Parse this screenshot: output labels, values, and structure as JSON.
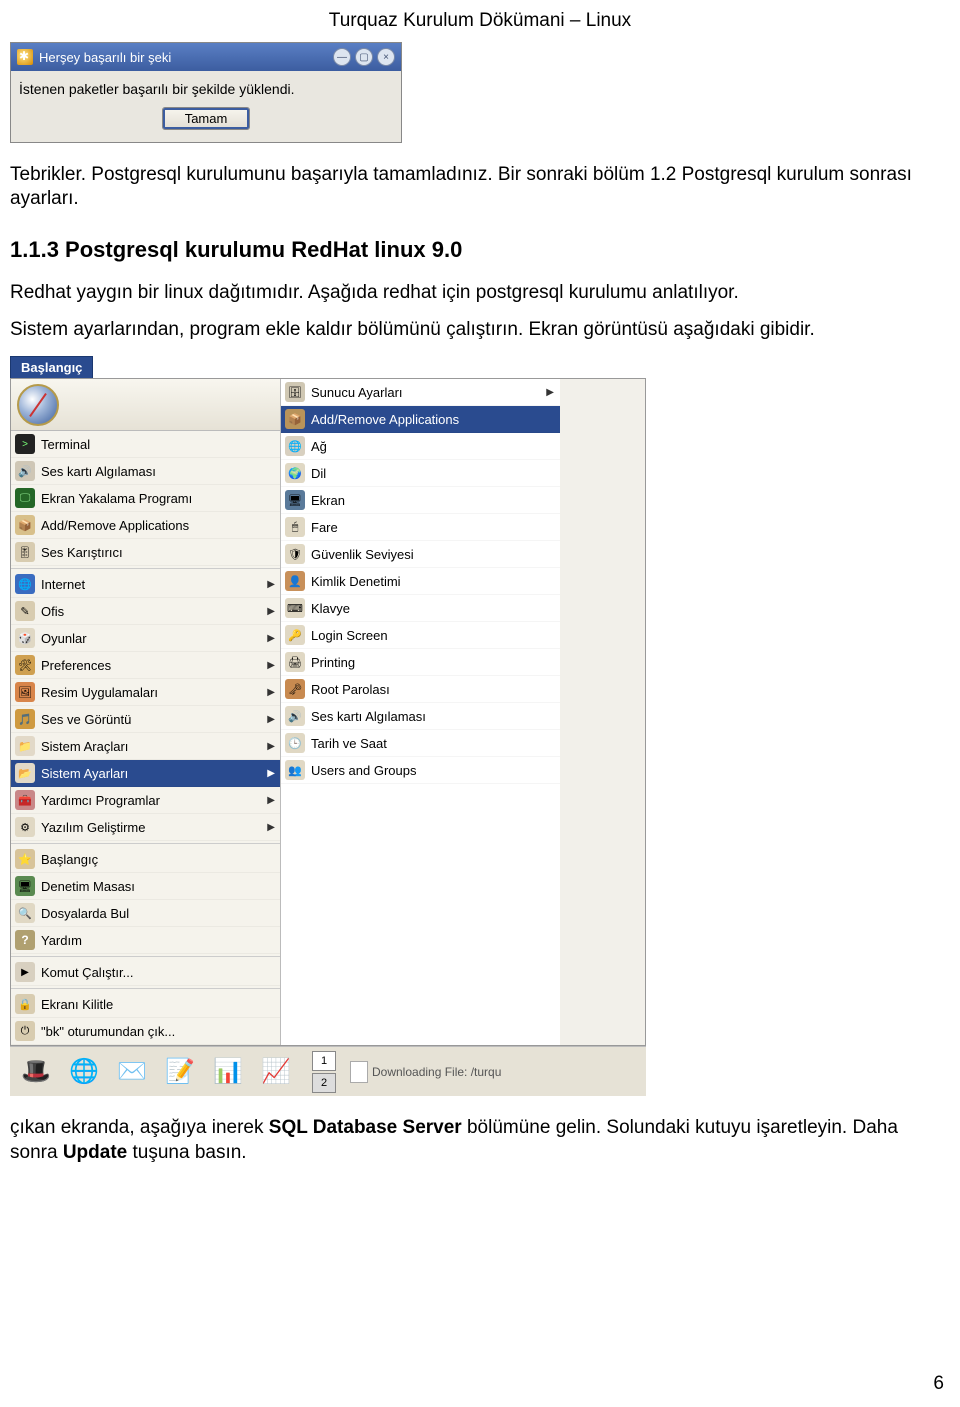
{
  "header": "Turquaz Kurulum Dökümani – Linux",
  "dialog": {
    "title": "Herşey başarılı bir şeki",
    "message": "İstenen paketler başarılı bir şekilde yüklendi.",
    "ok_label": "Tamam"
  },
  "para1": "Tebrikler. Postgresql kurulumunu başarıyla tamamladınız. Bir sonraki bölüm 1.2 Postgresql kurulum sonrası ayarları.",
  "heading": "1.1.3 Postgresql kurulumu RedHat linux 9.0",
  "para2": "Redhat yaygın bir linux dağıtımıdır. Aşağıda redhat için postgresql kurulumu anlatılıyor.",
  "para3": "Sistem ayarlarından, program ekle kaldır bölümünü çalıştırın. Ekran görüntüsü aşağıdaki gibidir.",
  "menu": {
    "start_label": "Başlangıç",
    "left": [
      {
        "label": "Terminal",
        "icon": "i-term",
        "arrow": false
      },
      {
        "label": "Ses kartı Algılaması",
        "icon": "i-sound",
        "arrow": false
      },
      {
        "label": "Ekran Yakalama Programı",
        "icon": "i-screen",
        "arrow": false
      },
      {
        "label": "Add/Remove Applications",
        "icon": "i-pkg",
        "arrow": false
      },
      {
        "label": "Ses Karıştırıcı",
        "icon": "i-mixer",
        "arrow": false
      },
      {
        "label": "Internet",
        "icon": "i-net",
        "arrow": true,
        "divider_before": true
      },
      {
        "label": "Ofis",
        "icon": "i-office",
        "arrow": true
      },
      {
        "label": "Oyunlar",
        "icon": "i-game",
        "arrow": true
      },
      {
        "label": "Preferences",
        "icon": "i-pref",
        "arrow": true
      },
      {
        "label": "Resim Uygulamaları",
        "icon": "i-img",
        "arrow": true
      },
      {
        "label": "Ses ve Görüntü",
        "icon": "i-av",
        "arrow": true
      },
      {
        "label": "Sistem Araçları",
        "icon": "i-tools",
        "arrow": true
      },
      {
        "label": "Sistem Ayarları",
        "icon": "i-settings",
        "arrow": true,
        "selected": true
      },
      {
        "label": "Yardımcı Programlar",
        "icon": "i-aux",
        "arrow": true
      },
      {
        "label": "Yazılım Geliştirme",
        "icon": "i-dev",
        "arrow": true
      },
      {
        "label": "Başlangıç",
        "icon": "i-start",
        "arrow": false,
        "divider_before": true
      },
      {
        "label": "Denetim Masası",
        "icon": "i-panel",
        "arrow": false
      },
      {
        "label": "Dosyalarda Bul",
        "icon": "i-search",
        "arrow": false
      },
      {
        "label": "Yardım",
        "icon": "i-help",
        "arrow": false
      },
      {
        "label": "Komut Çalıştır...",
        "icon": "i-run",
        "arrow": false,
        "divider_before": true
      },
      {
        "label": "Ekranı Kilitle",
        "icon": "i-lock",
        "arrow": false,
        "divider_before": true
      },
      {
        "label": "\"bk\" oturumundan çık...",
        "icon": "i-logout",
        "arrow": false
      }
    ],
    "right": [
      {
        "label": "Sunucu Ayarları",
        "icon": "i-server",
        "arrow": true
      },
      {
        "label": "Add/Remove Applications",
        "icon": "i-addrem",
        "arrow": false,
        "highlight": true
      },
      {
        "label": "Ağ",
        "icon": "i-ag",
        "arrow": false
      },
      {
        "label": "Dil",
        "icon": "i-dil",
        "arrow": false
      },
      {
        "label": "Ekran",
        "icon": "i-ekran",
        "arrow": false
      },
      {
        "label": "Fare",
        "icon": "i-fare",
        "arrow": false
      },
      {
        "label": "Güvenlik Seviyesi",
        "icon": "i-sec",
        "arrow": false
      },
      {
        "label": "Kimlik Denetimi",
        "icon": "i-id",
        "arrow": false
      },
      {
        "label": "Klavye",
        "icon": "i-kb",
        "arrow": false
      },
      {
        "label": "Login Screen",
        "icon": "i-login",
        "arrow": false
      },
      {
        "label": "Printing",
        "icon": "i-print",
        "arrow": false
      },
      {
        "label": "Root Parolası",
        "icon": "i-root",
        "arrow": false
      },
      {
        "label": "Ses kartı Algılaması",
        "icon": "i-scard",
        "arrow": false
      },
      {
        "label": "Tarih ve Saat",
        "icon": "i-date",
        "arrow": false
      },
      {
        "label": "Users and Groups",
        "icon": "i-users",
        "arrow": false
      }
    ],
    "taskbar": {
      "workspaces": [
        "1",
        "2"
      ],
      "active_ws": "1",
      "task_label": "Downloading File: /turqu"
    }
  },
  "lower": {
    "prefix": "çıkan ekranda, aşağıya inerek ",
    "bold1": "SQL Database Server",
    "mid": " bölümüne gelin. Solundaki kutuyu işaretleyin. Daha sonra ",
    "bold2": "Update",
    "suffix": " tuşuna basın."
  },
  "page_number": "6"
}
